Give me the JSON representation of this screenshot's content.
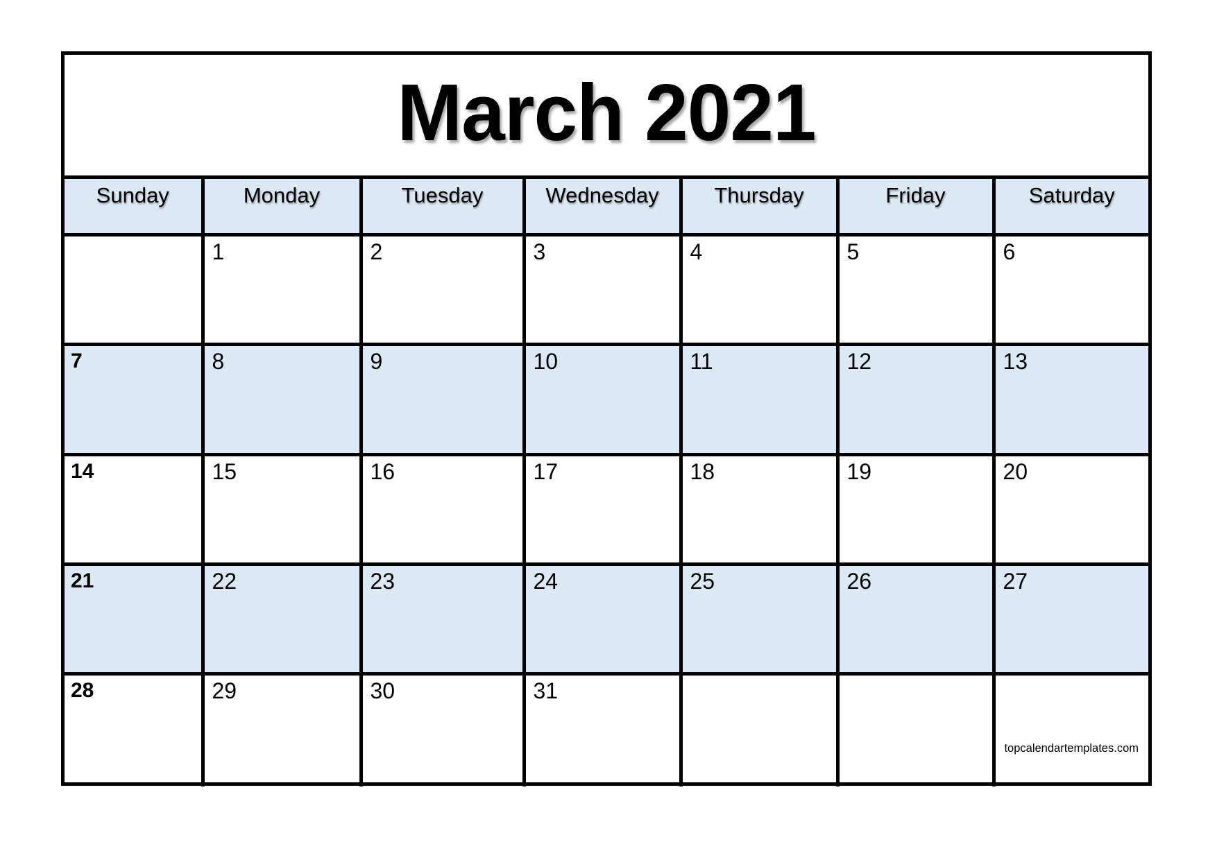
{
  "calendar": {
    "title": "March 2021",
    "month": "March",
    "year": 2021,
    "weekdays": [
      "Sunday",
      "Monday",
      "Tuesday",
      "Wednesday",
      "Thursday",
      "Friday",
      "Saturday"
    ],
    "weeks": [
      [
        "",
        "1",
        "2",
        "3",
        "4",
        "5",
        "6"
      ],
      [
        "7",
        "8",
        "9",
        "10",
        "11",
        "12",
        "13"
      ],
      [
        "14",
        "15",
        "16",
        "17",
        "18",
        "19",
        "20"
      ],
      [
        "21",
        "22",
        "23",
        "24",
        "25",
        "26",
        "27"
      ],
      [
        "28",
        "29",
        "30",
        "31",
        "",
        "",
        ""
      ]
    ],
    "shaded_weeks": [
      1,
      3
    ],
    "bold_column": "Sunday",
    "watermark": "topcalendartemplates.com"
  },
  "colors": {
    "border": "#000000",
    "shade": "#dde8f5",
    "background": "#ffffff",
    "text": "#000000"
  }
}
